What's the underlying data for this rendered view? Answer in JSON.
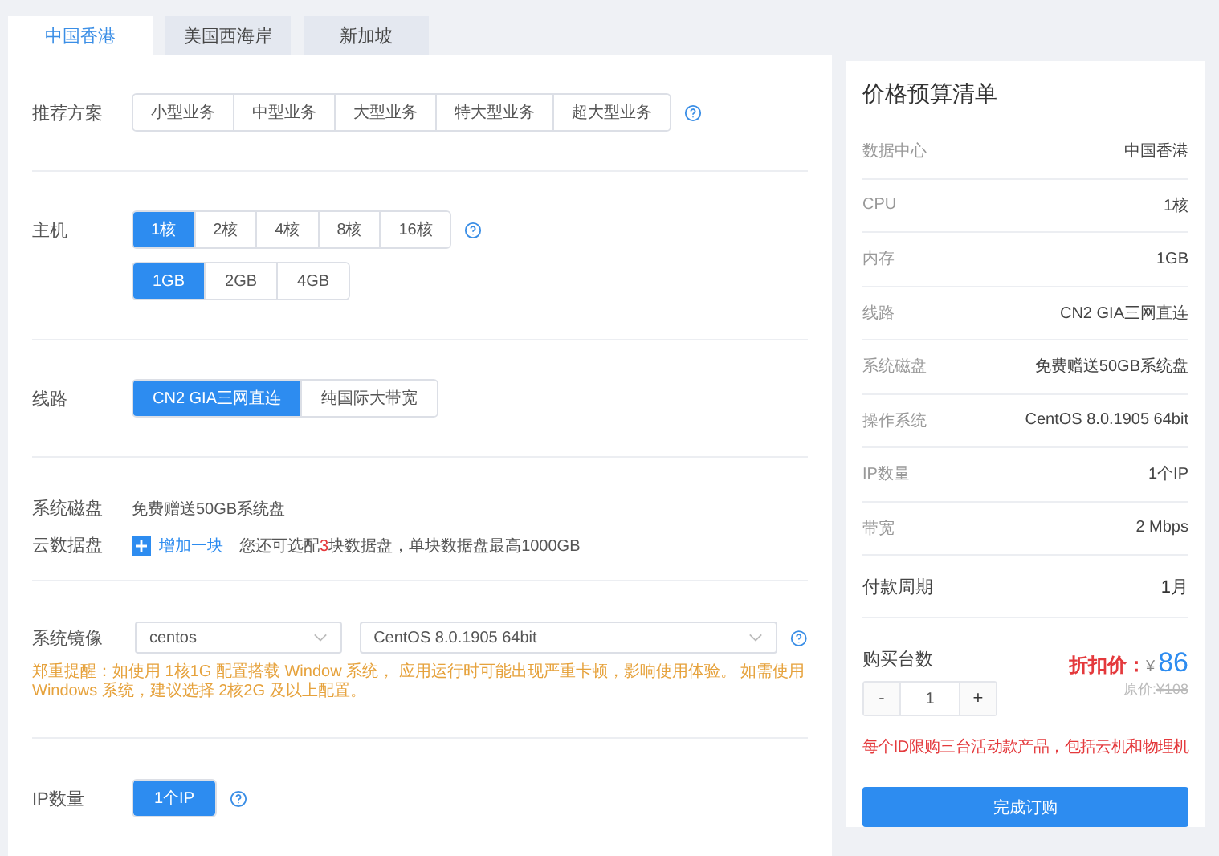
{
  "tabs": [
    {
      "label": "中国香港",
      "selected": true
    },
    {
      "label": "美国西海岸",
      "selected": false
    },
    {
      "label": "新加坡",
      "selected": false
    }
  ],
  "plan": {
    "label": "推荐方案",
    "options": [
      {
        "label": "小型业务",
        "selected": false
      },
      {
        "label": "中型业务",
        "selected": false
      },
      {
        "label": "大型业务",
        "selected": false
      },
      {
        "label": "特大型业务",
        "selected": false
      },
      {
        "label": "超大型业务",
        "selected": false
      }
    ]
  },
  "host": {
    "label": "主机",
    "cpu_options": [
      {
        "label": "1核",
        "selected": true
      },
      {
        "label": "2核",
        "selected": false
      },
      {
        "label": "4核",
        "selected": false
      },
      {
        "label": "8核",
        "selected": false
      },
      {
        "label": "16核",
        "selected": false
      }
    ],
    "memory_options": [
      {
        "label": "1GB",
        "selected": true
      },
      {
        "label": "2GB",
        "selected": false
      },
      {
        "label": "4GB",
        "selected": false
      }
    ]
  },
  "line": {
    "label": "线路",
    "options": [
      {
        "label": "CN2 GIA三网直连",
        "selected": true
      },
      {
        "label": "纯国际大带宽",
        "selected": false
      }
    ]
  },
  "system_disk": {
    "label": "系统磁盘",
    "value": "免费赠送50GB系统盘"
  },
  "data_disk": {
    "label": "云数据盘",
    "add": "增加一块",
    "note_before": "您还可选配",
    "count": "3",
    "note_after": "块数据盘，单块数据盘最高1000GB"
  },
  "image": {
    "label": "系统镜像",
    "os": "centos",
    "version": "CentOS 8.0.1905 64bit",
    "warning": "郑重提醒：如使用 1核1G 配置搭载 Window 系统， 应用运行时可能出现严重卡顿，影响使用体验。 如需使用 Windows 系统，建议选择 2核2G 及以上配置。"
  },
  "ip": {
    "label": "IP数量",
    "options": [
      {
        "label": "1个IP",
        "selected": true
      }
    ]
  },
  "summary": {
    "title": "价格预算清单",
    "rows": [
      {
        "label": "数据中心",
        "value": "中国香港"
      },
      {
        "label": "CPU",
        "value": "1核"
      },
      {
        "label": "内存",
        "value": "1GB"
      },
      {
        "label": "线路",
        "value": "CN2 GIA三网直连"
      },
      {
        "label": "系统磁盘",
        "value": "免费赠送50GB系统盘"
      },
      {
        "label": "操作系统",
        "value": "CentOS 8.0.1905 64bit"
      },
      {
        "label": "IP数量",
        "value": "1个IP"
      },
      {
        "label": "带宽",
        "value": "2 Mbps"
      }
    ],
    "period": {
      "label": "付款周期",
      "value": "1月"
    },
    "quantity": {
      "label": "购买台数",
      "minus": "-",
      "value": "1",
      "plus": "+"
    },
    "discount_label": "折扣价：",
    "currency": "¥",
    "price": "86",
    "original_label": "原价:",
    "original_price": "¥108",
    "limit_note": "每个ID限购三台活动款产品，包括云机和物理机",
    "submit": "完成订购"
  }
}
